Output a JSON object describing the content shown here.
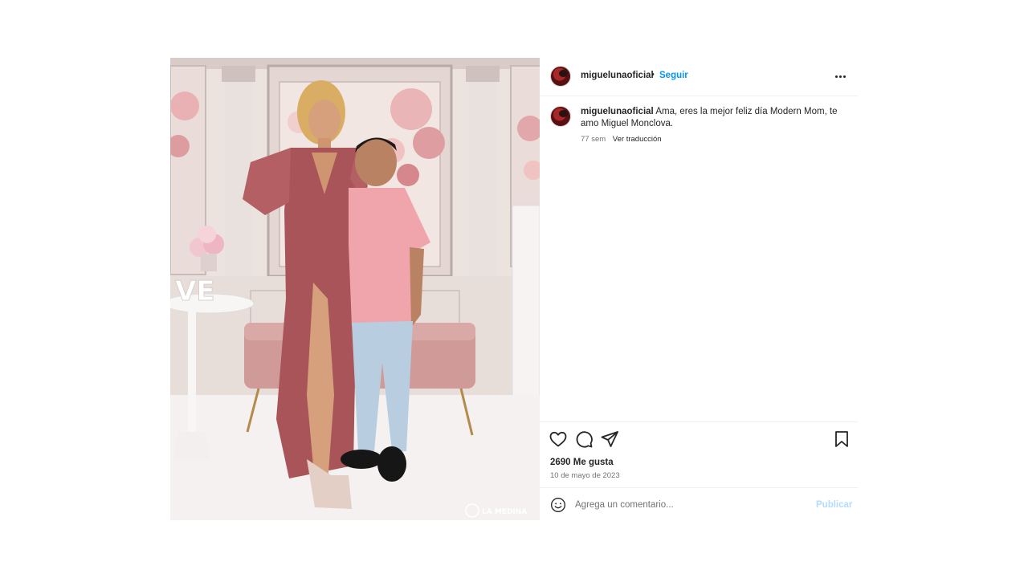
{
  "post": {
    "username": "miguelunaoficial",
    "separator": "•",
    "follow_label": "Seguir",
    "photo": {
      "subject": "photo-mother-and-son",
      "watermark": "LA MEDINA",
      "decor_text": "LOVE"
    },
    "caption": {
      "username": "miguelunaoficial",
      "text": "Ama, eres la mejor feliz día Modern Mom, te amo Miguel Monclova.",
      "time_ago": "77 sem",
      "translate_label": "Ver traducción"
    },
    "actions": {
      "like_icon": "heart-icon",
      "comment_icon": "comment-icon",
      "share_icon": "share-icon",
      "save_icon": "bookmark-icon"
    },
    "likes_text": "2690 Me gusta",
    "date_text": "10 de mayo de 2023",
    "comment_box": {
      "emoji_icon": "emoji-icon",
      "placeholder": "Agrega un comentario...",
      "publish_label": "Publicar"
    }
  },
  "colors": {
    "link_blue": "#0095f6",
    "publish_disabled": "#b3dbff",
    "secondary_text": "#737373",
    "divider": "#efefef"
  }
}
